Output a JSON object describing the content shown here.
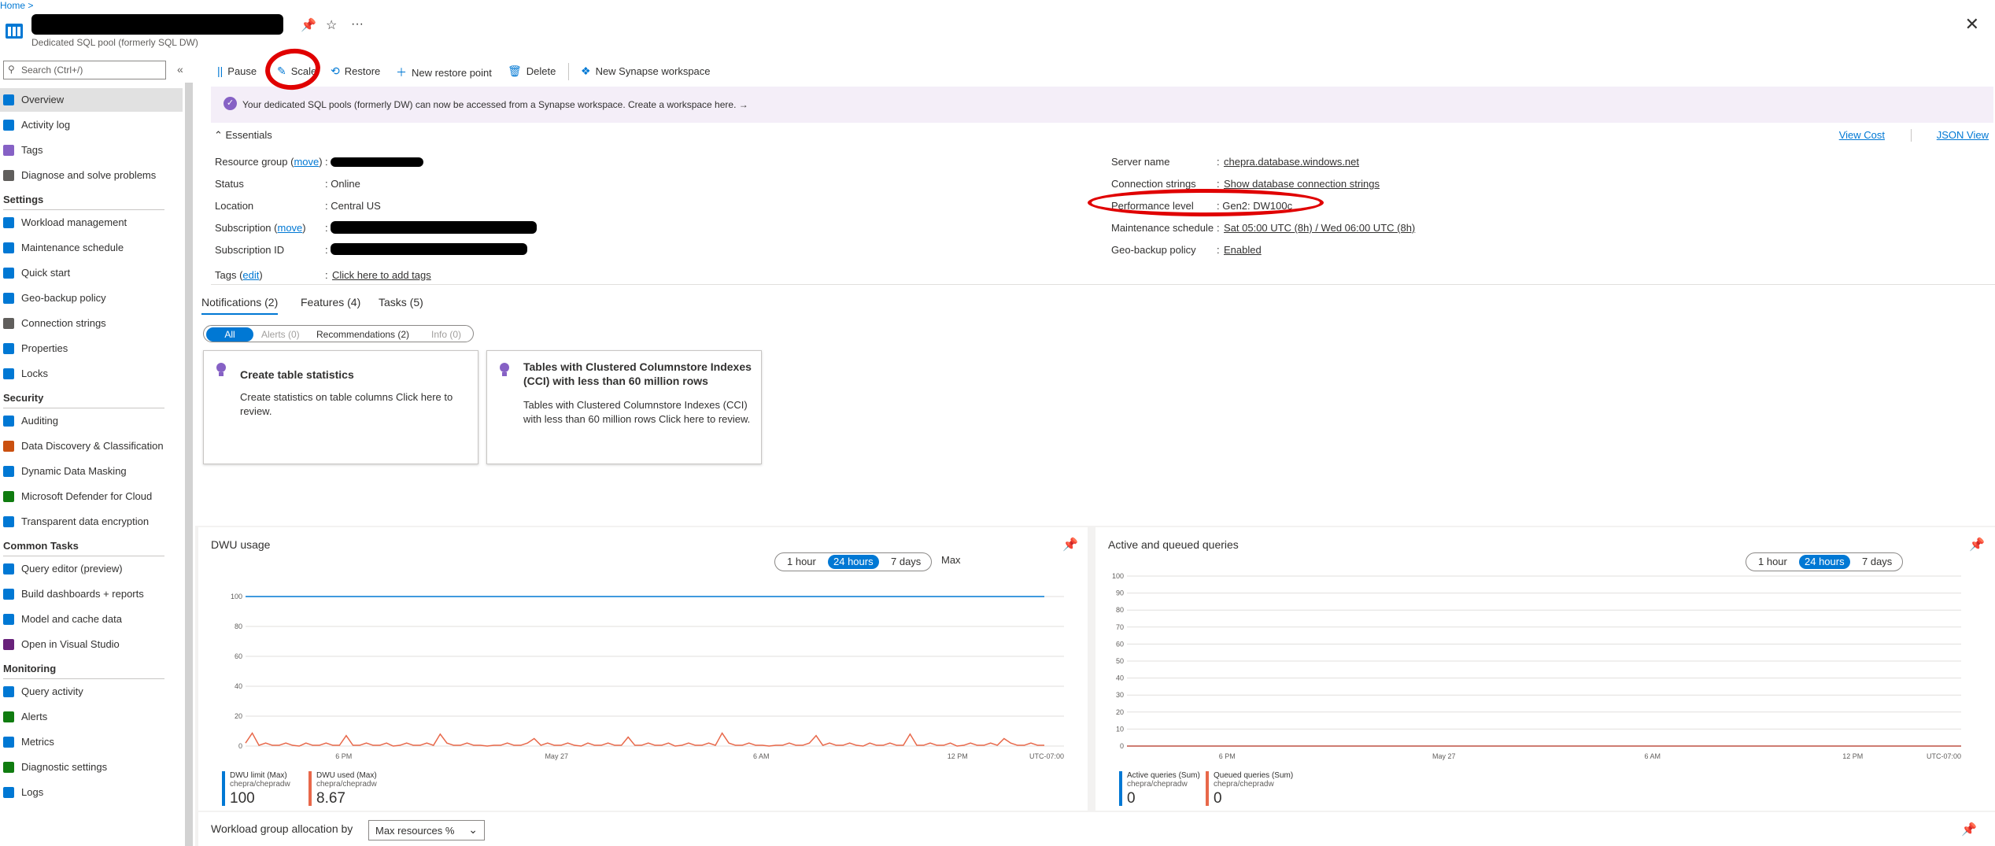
{
  "header": {
    "breadcrumb": "Home >",
    "subtitle": "Dedicated SQL pool (formerly SQL DW)",
    "more": "···",
    "close": "✕"
  },
  "sidebar": {
    "search_placeholder": "Search (Ctrl+/)",
    "collapse": "«",
    "items": [
      {
        "label": "Overview",
        "icon": "overview-icon",
        "color": "#0078d4"
      },
      {
        "label": "Activity log",
        "icon": "activity-log-icon",
        "color": "#0078d4"
      },
      {
        "label": "Tags",
        "icon": "tag-icon",
        "color": "#8661c5"
      },
      {
        "label": "Diagnose and solve problems",
        "icon": "wrench-icon",
        "color": "#605e5c"
      }
    ],
    "sections": [
      {
        "title": "Settings",
        "items": [
          {
            "label": "Workload management",
            "icon": "workload-icon",
            "color": "#0078d4"
          },
          {
            "label": "Maintenance schedule",
            "icon": "calendar-icon",
            "color": "#0078d4"
          },
          {
            "label": "Quick start",
            "icon": "cloud-icon",
            "color": "#0078d4"
          },
          {
            "label": "Geo-backup policy",
            "icon": "globe-icon",
            "color": "#0078d4"
          },
          {
            "label": "Connection strings",
            "icon": "plug-icon",
            "color": "#605e5c"
          },
          {
            "label": "Properties",
            "icon": "properties-icon",
            "color": "#0078d4"
          },
          {
            "label": "Locks",
            "icon": "lock-icon",
            "color": "#0078d4"
          }
        ]
      },
      {
        "title": "Security",
        "items": [
          {
            "label": "Auditing",
            "icon": "auditing-icon",
            "color": "#0078d4"
          },
          {
            "label": "Data Discovery & Classification",
            "icon": "data-discovery-icon",
            "color": "#ca5010"
          },
          {
            "label": "Dynamic Data Masking",
            "icon": "masking-icon",
            "color": "#0078d4"
          },
          {
            "label": "Microsoft Defender for Cloud",
            "icon": "defender-shield-icon",
            "color": "#107c10"
          },
          {
            "label": "Transparent data encryption",
            "icon": "shield-icon",
            "color": "#0078d4"
          }
        ]
      },
      {
        "title": "Common Tasks",
        "items": [
          {
            "label": "Query editor (preview)",
            "icon": "query-editor-icon",
            "color": "#0078d4"
          },
          {
            "label": "Build dashboards + reports",
            "icon": "dashboard-icon",
            "color": "#0078d4"
          },
          {
            "label": "Model and cache data",
            "icon": "model-icon",
            "color": "#0078d4"
          },
          {
            "label": "Open in Visual Studio",
            "icon": "visual-studio-icon",
            "color": "#68217a"
          }
        ]
      },
      {
        "title": "Monitoring",
        "items": [
          {
            "label": "Query activity",
            "icon": "query-activity-icon",
            "color": "#0078d4"
          },
          {
            "label": "Alerts",
            "icon": "alert-icon",
            "color": "#107c10"
          },
          {
            "label": "Metrics",
            "icon": "metrics-icon",
            "color": "#0078d4"
          },
          {
            "label": "Diagnostic settings",
            "icon": "diagnostic-icon",
            "color": "#107c10"
          },
          {
            "label": "Logs",
            "icon": "logs-icon",
            "color": "#0078d4"
          }
        ]
      }
    ]
  },
  "toolbar": {
    "pause": "Pause",
    "scale": "Scale",
    "restore": "Restore",
    "new_restore_point": "New restore point",
    "delete": "Delete",
    "new_synapse": "New Synapse workspace"
  },
  "banner": {
    "text": "Your dedicated SQL pools (formerly DW) can now be accessed from a Synapse workspace. Create a workspace here.",
    "arrow": "→"
  },
  "essentials": {
    "title": "Essentials",
    "view_cost": "View Cost",
    "json_view": "JSON View",
    "left": {
      "resource_group_label": "Resource group",
      "move": "move",
      "status_label": "Status",
      "status_value": "Online",
      "location_label": "Location",
      "location_value": "Central US",
      "subscription_label": "Subscription",
      "subscription_id_label": "Subscription ID",
      "tags_label": "Tags",
      "edit": "edit",
      "tags_value": "Click here to add tags"
    },
    "right": {
      "server_name_label": "Server name",
      "server_name_value": "chepra.database.windows.net",
      "connection_strings_label": "Connection strings",
      "connection_strings_value": "Show database connection strings",
      "performance_level_label": "Performance level",
      "performance_level_value": "Gen2: DW100c",
      "maintenance_label": "Maintenance schedule",
      "maintenance_value": "Sat 05:00 UTC (8h) / Wed 06:00 UTC (8h)",
      "geo_backup_label": "Geo-backup policy",
      "geo_backup_value": "Enabled"
    }
  },
  "tabs": {
    "notifications": "Notifications (2)",
    "features": "Features (4)",
    "tasks": "Tasks (5)"
  },
  "filters": {
    "all": "All",
    "alerts": "Alerts (0)",
    "recommendations": "Recommendations (2)",
    "info": "Info (0)"
  },
  "cards": [
    {
      "title": "Create table statistics",
      "body1": "Create statistics on table columns Click here to",
      "body2": "review."
    },
    {
      "title1": "Tables with Clustered Columnstore Indexes",
      "title2": "(CCI) with less than 60 million rows",
      "body1": "Tables with Clustered Columnstore Indexes (CCI)",
      "body2": "with less than 60 million rows Click here to review."
    }
  ],
  "charts": {
    "range_1h": "1 hour",
    "range_24h": "24 hours",
    "range_7d": "7 days",
    "max": "Max",
    "dwu": {
      "title": "DWU usage",
      "legend": [
        {
          "name1": "DWU limit (Max)",
          "name2": "chepra/chepradw",
          "value": "100",
          "color": "#0078d4"
        },
        {
          "name1": "DWU used (Max)",
          "name2": "chepra/chepradw",
          "value": "8.67",
          "color": "#e8684a"
        }
      ]
    },
    "queries": {
      "title": "Active and queued queries",
      "legend": [
        {
          "name1": "Active queries (Sum)",
          "name2": "chepra/chepradw",
          "value": "0",
          "color": "#0078d4"
        },
        {
          "name1": "Queued queries (Sum)",
          "name2": "chepra/chepradw",
          "value": "0",
          "color": "#e8684a"
        }
      ]
    }
  },
  "chart_data": [
    {
      "type": "line",
      "title": "DWU usage",
      "x_ticks": [
        "6 PM",
        "May 27",
        "6 AM",
        "12 PM",
        "UTC-07:00"
      ],
      "y_ticks": [
        0,
        20,
        40,
        60,
        80,
        100
      ],
      "ylim": [
        0,
        100
      ],
      "series": [
        {
          "name": "DWU limit (Max)",
          "values": [
            100,
            100,
            100,
            100,
            100,
            100,
            100,
            100,
            100,
            100
          ],
          "color": "#0078d4"
        },
        {
          "name": "DWU used (Max)",
          "values": [
            0,
            8.67,
            0,
            5,
            0,
            7,
            0,
            6,
            0,
            8
          ],
          "color": "#e8684a"
        }
      ]
    },
    {
      "type": "line",
      "title": "Active and queued queries",
      "x_ticks": [
        "6 PM",
        "May 27",
        "6 AM",
        "12 PM",
        "UTC-07:00"
      ],
      "y_ticks": [
        0,
        10,
        20,
        30,
        40,
        50,
        60,
        70,
        80,
        90,
        100
      ],
      "ylim": [
        0,
        100
      ],
      "series": [
        {
          "name": "Active queries (Sum)",
          "values": [
            0,
            0
          ],
          "color": "#0078d4"
        },
        {
          "name": "Queued queries (Sum)",
          "values": [
            0,
            0
          ],
          "color": "#e8684a"
        }
      ]
    }
  ],
  "workload": {
    "label": "Workload group allocation by",
    "select_value": "Max resources %"
  }
}
